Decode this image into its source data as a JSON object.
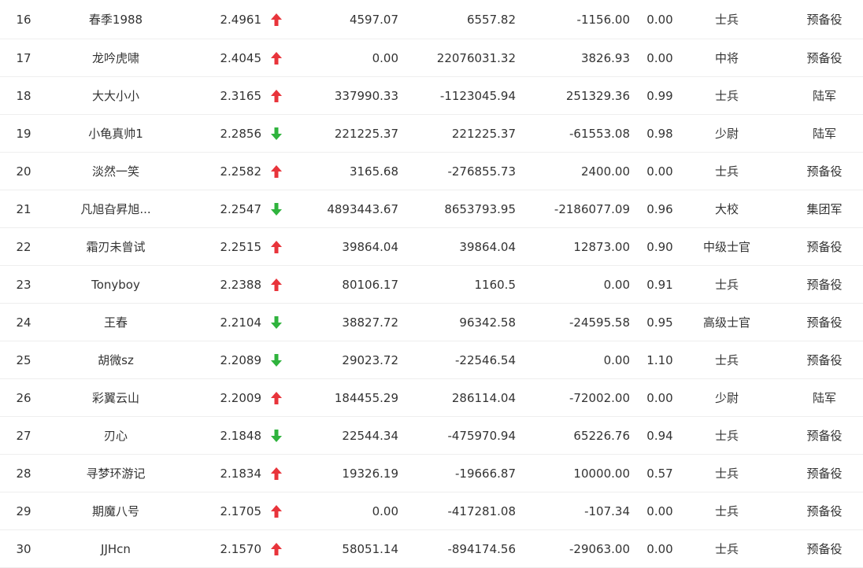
{
  "colors": {
    "up": "#e8343b",
    "down": "#2fb33d"
  },
  "rows": [
    {
      "rank": "16",
      "name": "春季1988",
      "score": "2.4961",
      "trend": "up",
      "v1": "4597.07",
      "v2": "6557.82",
      "v3": "-1156.00",
      "ratio": "0.00",
      "title": "士兵",
      "corps": "预备役"
    },
    {
      "rank": "17",
      "name": "龙吟虎啸",
      "score": "2.4045",
      "trend": "up",
      "v1": "0.00",
      "v2": "22076031.32",
      "v3": "3826.93",
      "ratio": "0.00",
      "title": "中将",
      "corps": "预备役"
    },
    {
      "rank": "18",
      "name": "大大小小",
      "score": "2.3165",
      "trend": "up",
      "v1": "337990.33",
      "v2": "-1123045.94",
      "v3": "251329.36",
      "ratio": "0.99",
      "title": "士兵",
      "corps": "陆军"
    },
    {
      "rank": "19",
      "name": "小龟真帅1",
      "score": "2.2856",
      "trend": "down",
      "v1": "221225.37",
      "v2": "221225.37",
      "v3": "-61553.08",
      "ratio": "0.98",
      "title": "少尉",
      "corps": "陆军"
    },
    {
      "rank": "20",
      "name": "淡然一笑",
      "score": "2.2582",
      "trend": "up",
      "v1": "3165.68",
      "v2": "-276855.73",
      "v3": "2400.00",
      "ratio": "0.00",
      "title": "士兵",
      "corps": "预备役"
    },
    {
      "rank": "21",
      "name": "凡旭旮昇旭...",
      "score": "2.2547",
      "trend": "down",
      "v1": "4893443.67",
      "v2": "8653793.95",
      "v3": "-2186077.09",
      "ratio": "0.96",
      "title": "大校",
      "corps": "集团军"
    },
    {
      "rank": "22",
      "name": "霜刃未曾试",
      "score": "2.2515",
      "trend": "up",
      "v1": "39864.04",
      "v2": "39864.04",
      "v3": "12873.00",
      "ratio": "0.90",
      "title": "中级士官",
      "corps": "预备役"
    },
    {
      "rank": "23",
      "name": "Tonyboy",
      "score": "2.2388",
      "trend": "up",
      "v1": "80106.17",
      "v2": "1160.5",
      "v3": "0.00",
      "ratio": "0.91",
      "title": "士兵",
      "corps": "预备役"
    },
    {
      "rank": "24",
      "name": "王春",
      "score": "2.2104",
      "trend": "down",
      "v1": "38827.72",
      "v2": "96342.58",
      "v3": "-24595.58",
      "ratio": "0.95",
      "title": "高级士官",
      "corps": "预备役"
    },
    {
      "rank": "25",
      "name": "胡微sz",
      "score": "2.2089",
      "trend": "down",
      "v1": "29023.72",
      "v2": "-22546.54",
      "v3": "0.00",
      "ratio": "1.10",
      "title": "士兵",
      "corps": "预备役"
    },
    {
      "rank": "26",
      "name": "彩翼云山",
      "score": "2.2009",
      "trend": "up",
      "v1": "184455.29",
      "v2": "286114.04",
      "v3": "-72002.00",
      "ratio": "0.00",
      "title": "少尉",
      "corps": "陆军"
    },
    {
      "rank": "27",
      "name": "刃心",
      "score": "2.1848",
      "trend": "down",
      "v1": "22544.34",
      "v2": "-475970.94",
      "v3": "65226.76",
      "ratio": "0.94",
      "title": "士兵",
      "corps": "预备役"
    },
    {
      "rank": "28",
      "name": "寻梦环游记",
      "score": "2.1834",
      "trend": "up",
      "v1": "19326.19",
      "v2": "-19666.87",
      "v3": "10000.00",
      "ratio": "0.57",
      "title": "士兵",
      "corps": "预备役"
    },
    {
      "rank": "29",
      "name": "期魔八号",
      "score": "2.1705",
      "trend": "up",
      "v1": "0.00",
      "v2": "-417281.08",
      "v3": "-107.34",
      "ratio": "0.00",
      "title": "士兵",
      "corps": "预备役"
    },
    {
      "rank": "30",
      "name": "JJHcn",
      "score": "2.1570",
      "trend": "up",
      "v1": "58051.14",
      "v2": "-894174.56",
      "v3": "-29063.00",
      "ratio": "0.00",
      "title": "士兵",
      "corps": "预备役"
    }
  ]
}
